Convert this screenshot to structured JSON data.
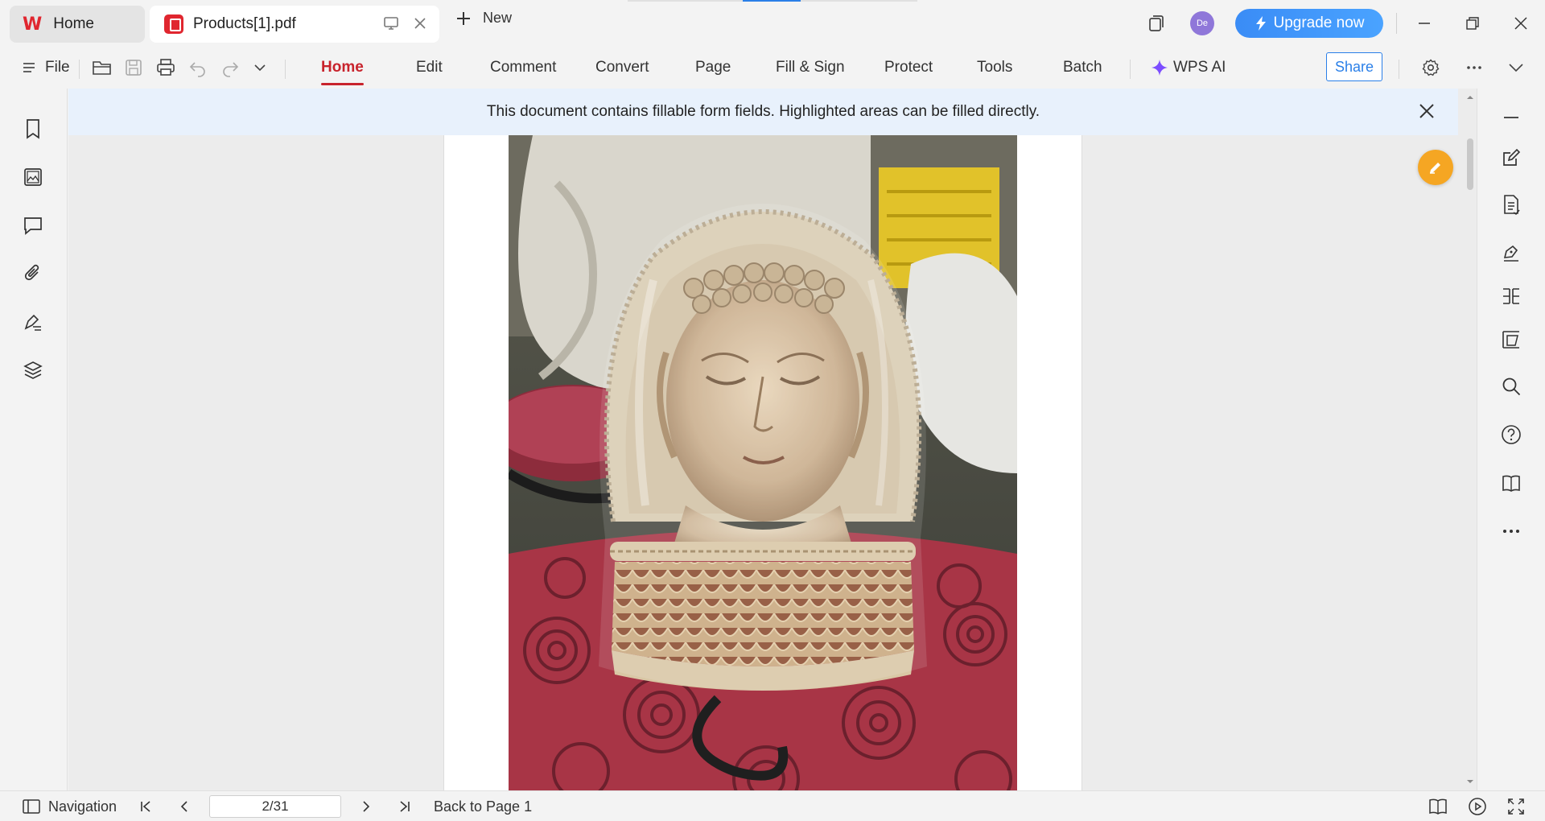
{
  "titlebar": {
    "tabs": [
      {
        "label": "Home",
        "icon": "wps-logo-icon"
      },
      {
        "label": "Products[1].pdf",
        "icon": "pdf-file-icon"
      }
    ],
    "new_tab_label": "New",
    "avatar_initials": "De",
    "upgrade_label": "Upgrade now"
  },
  "ribbon": {
    "file_label": "File",
    "tabs": [
      "Home",
      "Edit",
      "Comment",
      "Convert",
      "Page",
      "Fill & Sign",
      "Protect",
      "Tools",
      "Batch"
    ],
    "active_tab": "Home",
    "ai_label": "WPS AI",
    "share_label": "Share"
  },
  "notice": {
    "text": "This document contains fillable form fields. Highlighted areas can be filled directly."
  },
  "left_sidebar": {
    "icons": [
      "bookmark-icon",
      "image-icon",
      "comment-icon",
      "attachment-icon",
      "signature-icon",
      "layers-icon"
    ]
  },
  "right_sidebar": {
    "icons": [
      "minimize-panel-icon",
      "edit-doc-icon",
      "doc-list-icon",
      "pen-sign-icon",
      "compare-icon",
      "scan-icon",
      "search-icon",
      "help-icon",
      "book-icon",
      "more-icon"
    ]
  },
  "document": {
    "image_description": "Carved wooden Buddha head statue in plastic wrap on red patterned surface"
  },
  "statusbar": {
    "navigation_label": "Navigation",
    "page_value": "2/31",
    "back_label": "Back to Page 1"
  },
  "colors": {
    "accent_red": "#c8232c",
    "brand_blue": "#2a7fe8",
    "notice_bg": "#e8f1fc",
    "fill_orange": "#f5a623"
  }
}
